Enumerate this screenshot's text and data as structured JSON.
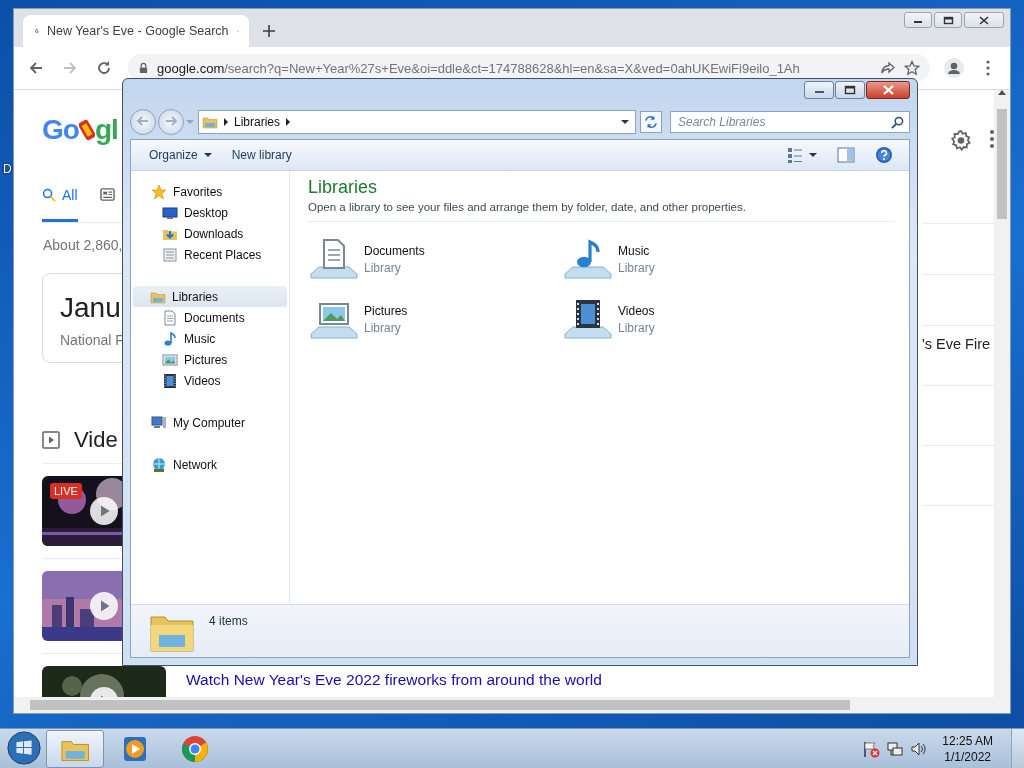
{
  "desktop": {
    "icon_label": "D"
  },
  "browser": {
    "tabs": [
      {
        "title": "New Year's Eve - Google Search",
        "selected": true
      }
    ],
    "back": {
      "disabled": false
    },
    "forward": {
      "disabled": true
    },
    "address": {
      "host": "google.com",
      "path": "/search?q=New+Year%27s+Eve&oi=ddle&ct=174788628&hl=en&sa=X&ved=0ahUKEwiFi9eilo_1Ah"
    },
    "page": {
      "logo": {
        "parts": [
          "Go",
          "gl"
        ]
      },
      "search_tabs": [
        {
          "kind": "all",
          "label": "All",
          "selected": true
        },
        {
          "kind": "news",
          "selected": false
        }
      ],
      "result_stats": "About 2,860,",
      "card": {
        "title": "Janu",
        "subtitle": "National F"
      },
      "side_result": "'s Eve Fire",
      "videos": {
        "heading": "Vide",
        "items": [
          {
            "kind": "picture",
            "badge": "LIVE"
          },
          {
            "kind": "picture"
          },
          {
            "kind": "picture",
            "title": "Watch New Year's Eve 2022 fireworks from around the world"
          }
        ]
      }
    }
  },
  "explorer": {
    "address": {
      "crumbs": [
        "Libraries"
      ]
    },
    "search": {
      "placeholder": "Search Libraries"
    },
    "commands": [
      {
        "label": "Organize",
        "menu": true
      },
      {
        "label": "New library",
        "menu": false
      }
    ],
    "nav": [
      {
        "kind": "star",
        "label": "Favorites",
        "selected": false,
        "children": [
          {
            "kind": "desktop",
            "label": "Desktop",
            "selected": false
          },
          {
            "kind": "downloads",
            "label": "Downloads",
            "selected": false
          },
          {
            "kind": "recent",
            "label": "Recent Places",
            "selected": false
          }
        ]
      },
      {
        "kind": "libraries",
        "label": "Libraries",
        "selected": true,
        "children": [
          {
            "kind": "documents",
            "label": "Documents",
            "selected": false
          },
          {
            "kind": "music",
            "label": "Music",
            "selected": false
          },
          {
            "kind": "pictures",
            "label": "Pictures",
            "selected": false
          },
          {
            "kind": "videos",
            "label": "Videos",
            "selected": false
          }
        ]
      },
      {
        "kind": "computer",
        "label": "My Computer",
        "selected": false
      },
      {
        "kind": "network",
        "label": "Network",
        "selected": false
      }
    ],
    "title": "Libraries",
    "description": "Open a library to see your files and arrange them by folder, date, and other properties.",
    "libraries": [
      {
        "kind": "documents",
        "name": "Documents",
        "type": "Library"
      },
      {
        "kind": "music",
        "name": "Music",
        "type": "Library"
      },
      {
        "kind": "pictures",
        "name": "Pictures",
        "type": "Library"
      },
      {
        "kind": "videos",
        "name": "Videos",
        "type": "Library"
      }
    ],
    "status": "4 items"
  },
  "taskbar": {
    "buttons": [
      {
        "kind": "explorer",
        "selected": true
      },
      {
        "kind": "media",
        "selected": false
      },
      {
        "kind": "chrome",
        "selected": false
      }
    ],
    "time": "12:25 AM",
    "date": "1/1/2022"
  }
}
